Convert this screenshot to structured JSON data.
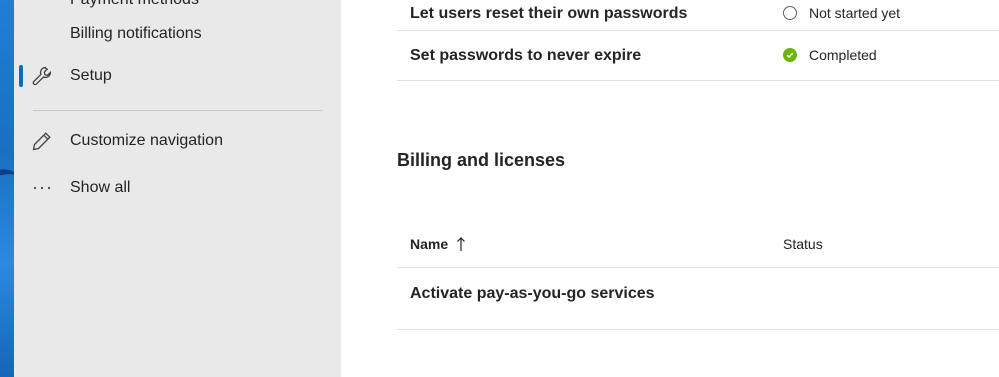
{
  "sidebar": {
    "items": [
      {
        "label": "Payment methods",
        "icon": "none"
      },
      {
        "label": "Billing notifications",
        "icon": "none"
      },
      {
        "label": "Setup",
        "icon": "wrench-icon",
        "active": true
      },
      {
        "label": "Customize navigation",
        "icon": "pencil-icon"
      },
      {
        "label": "Show all",
        "icon": "ellipsis-icon"
      }
    ]
  },
  "main": {
    "top_rows": [
      {
        "name": "Let users reset their own passwords",
        "status": "Not started yet",
        "status_type": "not-started"
      },
      {
        "name": "Set passwords to never expire",
        "status": "Completed",
        "status_type": "completed"
      }
    ],
    "billing": {
      "title": "Billing and licenses",
      "header": {
        "name": "Name",
        "sort_icon": "arrow-up-icon",
        "status": "Status"
      },
      "rows": [
        {
          "name": "Activate pay-as-you-go services",
          "status": ""
        }
      ]
    }
  },
  "colors": {
    "accent": "#0f6cbd",
    "completed": "#6bb700",
    "sidebar_bg": "#e9e9e9"
  }
}
